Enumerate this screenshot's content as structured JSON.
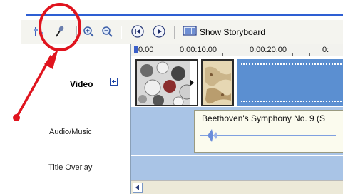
{
  "toolbar": {
    "show_storyboard_label": "Show Storyboard",
    "icons": [
      "set-audio-levels-icon",
      "narrate-timeline-icon",
      "zoom-in-icon",
      "zoom-out-icon",
      "rewind-icon",
      "play-icon",
      "storyboard-icon"
    ]
  },
  "tracks": {
    "video_label": "Video",
    "audio_label": "Audio/Music",
    "overlay_label": "Title Overlay"
  },
  "ruler": {
    "ticks": [
      "0.00",
      "0:00:10.00",
      "0:00:20.00",
      "0:"
    ]
  },
  "audio_clip": {
    "title": "Beethoven's Symphony No. 9 (S"
  },
  "colors": {
    "accent": "#2e5fd3",
    "track": "#a9c4e6",
    "annotation": "#e0141e"
  }
}
